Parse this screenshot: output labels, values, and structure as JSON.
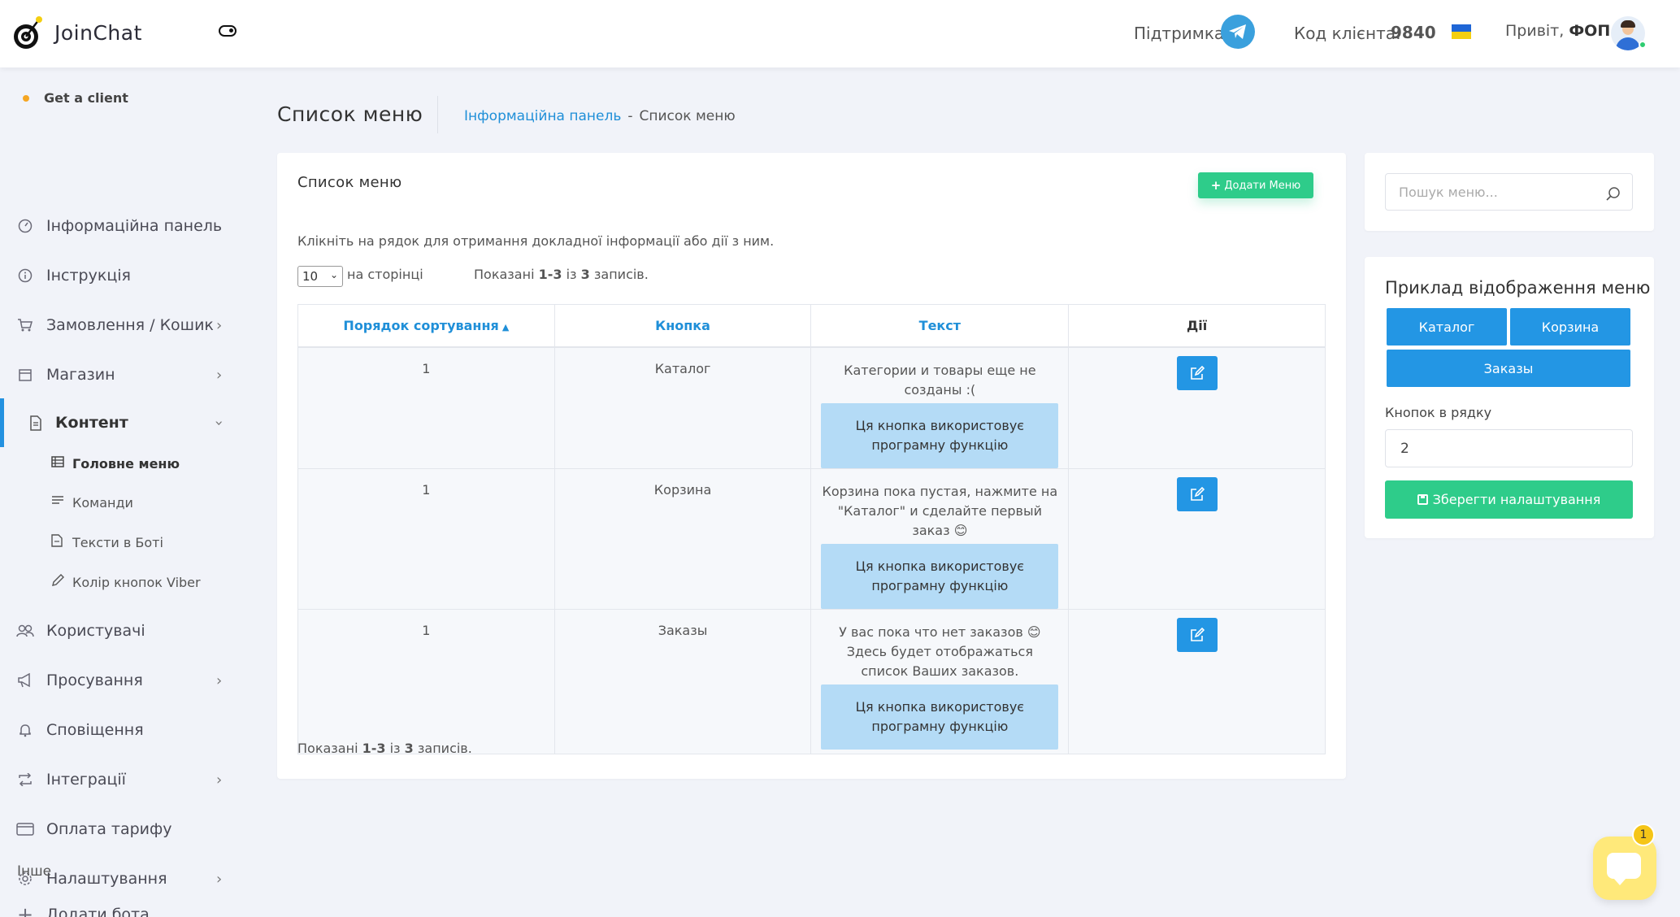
{
  "header": {
    "brand": "JoinChat",
    "support_label": "Підтримка",
    "client_code_label": "Код клієнта:",
    "client_code": "9840",
    "greeting": "Привіт,",
    "user_name": "ФОП"
  },
  "sidebar": {
    "workspace": "Get a client",
    "items": [
      {
        "label": "Інформаційна панель",
        "icon": "dashboard-icon"
      },
      {
        "label": "Інструкція",
        "icon": "info-icon"
      },
      {
        "label": "Замовлення / Кошик",
        "icon": "cart-icon",
        "has_children": true
      },
      {
        "label": "Магазин",
        "icon": "store-icon",
        "has_children": true
      },
      {
        "label": "Контент",
        "icon": "document-icon",
        "has_children": true,
        "expanded": true
      },
      {
        "label": "Користувачі",
        "icon": "users-icon"
      },
      {
        "label": "Просування",
        "icon": "megaphone-icon",
        "has_children": true
      },
      {
        "label": "Сповіщення",
        "icon": "bell-icon"
      },
      {
        "label": "Інтеграції",
        "icon": "integration-icon",
        "has_children": true
      },
      {
        "label": "Оплата тарифу",
        "icon": "credit-card-icon"
      },
      {
        "label": "Налаштування",
        "icon": "gear-icon",
        "has_children": true
      }
    ],
    "sub_items": [
      {
        "label": "Головне меню",
        "icon": "table-icon",
        "current": true
      },
      {
        "label": "Команди",
        "icon": "list-icon"
      },
      {
        "label": "Тексти в Боті",
        "icon": "file-text-icon"
      },
      {
        "label": "Колір кнопок Viber",
        "icon": "pencil-icon"
      }
    ],
    "section_other": "Інше",
    "add_bot": "Додати бота"
  },
  "page": {
    "title": "Список меню",
    "breadcrumb": {
      "home": "Інформаційна панель",
      "separator": "-",
      "current": "Список меню"
    }
  },
  "menu_list": {
    "card_title": "Список меню",
    "add_button": "Додати Меню",
    "hint": "Клікніть на рядок для отримання докладної інформації або дії з ним.",
    "per_page_value": "10",
    "per_page_label": "на сторінці",
    "shown_prefix": "Показані",
    "shown_range": "1-3",
    "shown_of": "із",
    "shown_total": "3",
    "shown_suffix": "записів.",
    "columns": [
      "Порядок сортування",
      "Кнопка",
      "Текст",
      "Дії"
    ],
    "function_note": "Ця кнопка використовує програмну функцію",
    "rows": [
      {
        "order": "1",
        "button": "Каталог",
        "text": "Категории и товары еще не созданы :("
      },
      {
        "order": "1",
        "button": "Корзина",
        "text": "Корзина пока пустая, нажмите на \"Каталог\" и сделайте первый заказ 😊"
      },
      {
        "order": "1",
        "button": "Заказы",
        "text": "У вас пока что нет заказов 😊 Здесь будет отображаться список Ваших заказов."
      }
    ]
  },
  "search": {
    "placeholder": "Пошук меню..."
  },
  "preview": {
    "title": "Приклад відображення меню",
    "buttons": [
      "Каталог",
      "Корзина",
      "Заказы"
    ],
    "row_label": "Кнопок в рядку",
    "row_value": "2",
    "save_button": "Зберегти налаштування"
  },
  "chat_widget": {
    "badge": "1"
  },
  "colors": {
    "accent_blue": "#2396e4",
    "accent_green": "#2ecc8a",
    "link": "#1f8fd8"
  }
}
